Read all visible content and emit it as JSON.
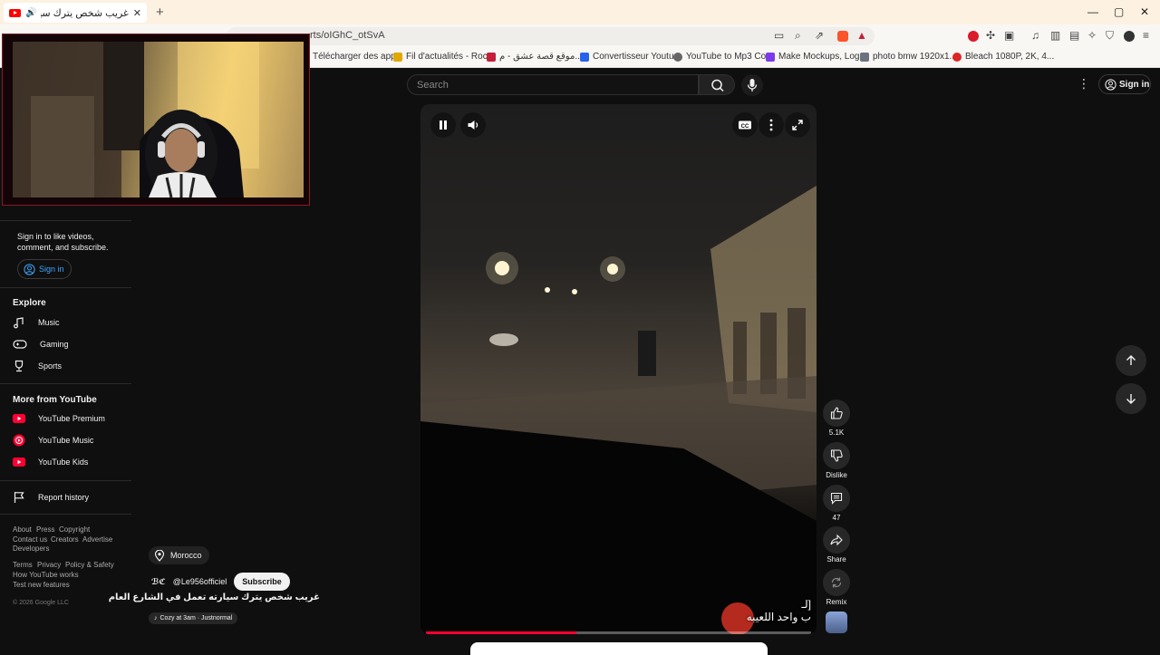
{
  "browser": {
    "tab": {
      "title": "غريب شخص يترك سيارته تعمل...",
      "close": "✕"
    },
    "new_tab": "+",
    "window": {
      "minimize": "—",
      "maximize": "▢",
      "close": "✕"
    },
    "url": "rts/oIGhC_otSvA",
    "bookmarks": [
      {
        "label": "Télécharger des app...",
        "color": "#3b82f6"
      },
      {
        "label": "Fil d'actualités - Roc...",
        "color": "#e0a800"
      },
      {
        "label": "موقع قصة عشق - م...",
        "color": "#c41e3a"
      },
      {
        "label": "Convertisseur Youtu...",
        "color": "#2563eb"
      },
      {
        "label": "YouTube to Mp3 Co...",
        "color": "#333333"
      },
      {
        "label": "Make Mockups, Log...",
        "color": "#7c3aed"
      },
      {
        "label": "photo bmw 1920x1...",
        "color": "#6b7280"
      },
      {
        "label": "Bleach 1080P, 2K, 4...",
        "color": "#dc2626"
      }
    ]
  },
  "header": {
    "search_placeholder": "Search",
    "sign_in": "Sign in"
  },
  "sidebar": {
    "signin_prompt": "Sign in to like videos, comment, and subscribe.",
    "signin_button": "Sign in",
    "explore_title": "Explore",
    "explore": [
      {
        "label": "Music",
        "icon": "music-note-icon"
      },
      {
        "label": "Gaming",
        "icon": "gamepad-icon"
      },
      {
        "label": "Sports",
        "icon": "trophy-icon"
      }
    ],
    "more_title": "More from YouTube",
    "more": [
      {
        "label": "YouTube Premium"
      },
      {
        "label": "YouTube Music"
      },
      {
        "label": "YouTube Kids"
      }
    ],
    "report": "Report history",
    "footer1": [
      "About",
      "Press",
      "Copyright",
      "Contact us",
      "Creators",
      "Advertise",
      "Developers"
    ],
    "footer2": [
      "Terms",
      "Privacy",
      "Policy & Safety",
      "How YouTube works",
      "Test new features"
    ],
    "copyright": "© 2026 Google LLC"
  },
  "short": {
    "location": "Morocco",
    "channel_handle": "@Le956officiel",
    "channel_logo": "ℬℭ",
    "subscribe": "Subscribe",
    "title": "غريب شخص يترك سيارته تعمل في الشارع العام",
    "music": "Cozy at 3am · Justnormal",
    "caption_line1": "[لـ",
    "caption_line2": "ب واحد اللعيبه",
    "progress": 0.39
  },
  "actions": {
    "like_count": "5.1K",
    "dislike": "Dislike",
    "comments": "47",
    "share": "Share",
    "remix": "Remix"
  },
  "colors": {
    "accent_red": "#ff0033",
    "link_blue": "#3ea6ff",
    "background": "#0f0f0f"
  }
}
